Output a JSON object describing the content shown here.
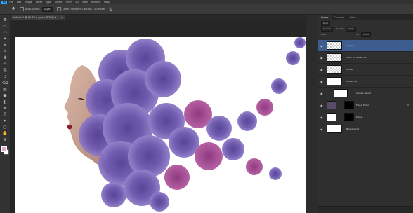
{
  "app": {
    "logo": "Ps",
    "menu": [
      "File",
      "Edit",
      "Image",
      "Layer",
      "Type",
      "Select",
      "Filter",
      "3D",
      "View",
      "Window",
      "Help"
    ]
  },
  "options": {
    "tool_icon": "move-tool-icon",
    "auto_select_label": "Auto-Select:",
    "auto_select_value": "Layer",
    "transform_label": "Show Transform Controls",
    "mode_label": "3D Mode:"
  },
  "document": {
    "tab_title": "Untitled-1 @ 66.7% (Layer 1, RGB/8) *",
    "close_glyph": "×"
  },
  "tools": [
    "move-tool",
    "marquee-tool",
    "lasso-tool",
    "magic-wand-tool",
    "crop-tool",
    "eyedropper-tool",
    "healing-tool",
    "brush-tool",
    "clone-stamp-tool",
    "history-brush-tool",
    "eraser-tool",
    "gradient-tool",
    "blur-tool",
    "dodge-tool",
    "pen-tool",
    "type-tool",
    "path-selection-tool",
    "rectangle-tool",
    "hand-tool",
    "zoom-tool"
  ],
  "colors": {
    "foreground": "#e3a6cf",
    "background": "#ffffff",
    "selection": "#3d5d8e",
    "smoke": "#6a58a8"
  },
  "panel": {
    "tabs": [
      "Layers",
      "Channels",
      "Paths"
    ],
    "filter_label": "Kind",
    "blend_mode": "Normal",
    "opacity_label": "Opacity:",
    "opacity_value": "100%",
    "lock_label": "Lock:",
    "fill_label": "Fill:",
    "fill_value": "100%"
  },
  "layers": [
    {
      "name": "Layer 1",
      "selected": true,
      "fx": ""
    },
    {
      "name": "Color Fill Smoke 01",
      "selected": false,
      "fx": ""
    },
    {
      "name": "Smoke",
      "selected": false,
      "fx": ""
    },
    {
      "name": "Smoke Fill",
      "selected": false,
      "fx": ""
    },
    {
      "name": "Curves Adjust",
      "selected": false,
      "fx": ""
    },
    {
      "name": "Model Photo",
      "selected": false,
      "fx": "fx"
    },
    {
      "name": "Model",
      "selected": false,
      "fx": ""
    },
    {
      "name": "Background",
      "selected": false,
      "fx": ""
    }
  ]
}
